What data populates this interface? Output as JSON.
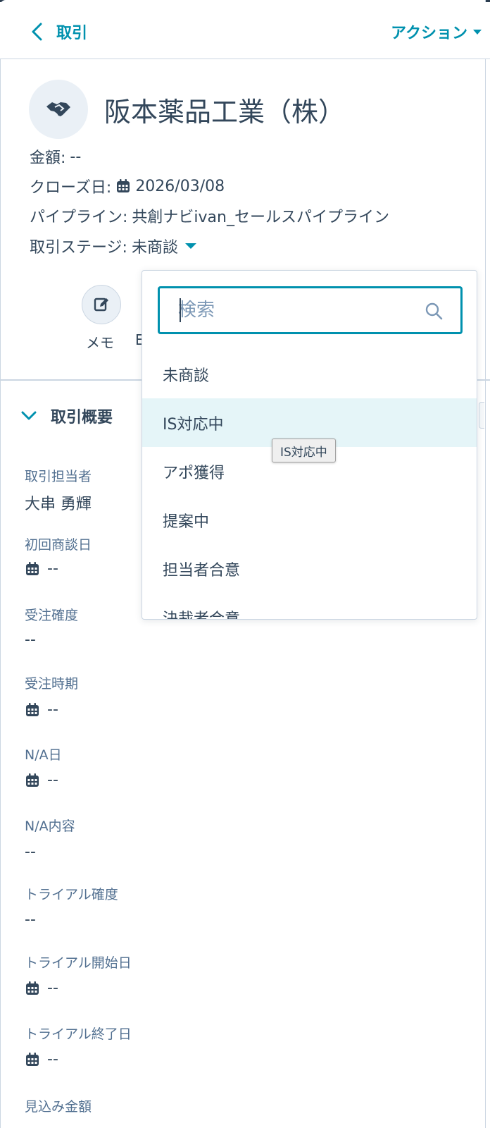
{
  "header": {
    "back_label": "取引",
    "actions_label": "アクション"
  },
  "record": {
    "title": "阪本薬品工業（株）",
    "amount_label": "金額:",
    "amount_value": "--",
    "close_date_label": "クローズ日:",
    "close_date_value": "2026/03/08",
    "pipeline_label": "パイプライン:",
    "pipeline_value": "共創ナビivan_セールスパイプライン",
    "stage_label": "取引ステージ:",
    "stage_value": "未商談"
  },
  "quick_actions": {
    "memo_label": "メモ",
    "next_label_partial": "E"
  },
  "summary": {
    "section_title": "取引概要",
    "fields": [
      {
        "label": "取引担当者",
        "value": "大串 勇輝"
      },
      {
        "label": "初回商談日",
        "value": "--"
      },
      {
        "label": "受注確度",
        "value": "--"
      },
      {
        "label": "受注時期",
        "value": "--"
      },
      {
        "label": "N/A日",
        "value": "--"
      },
      {
        "label": "N/A内容",
        "value": "--"
      },
      {
        "label": "トライアル確度",
        "value": "--"
      },
      {
        "label": "トライアル開始日",
        "value": "--"
      },
      {
        "label": "トライアル終了日",
        "value": "--"
      },
      {
        "label": "見込み金額",
        "value": ""
      }
    ]
  },
  "stage_dropdown": {
    "search_placeholder": "検索",
    "options": [
      "未商談",
      "IS対応中",
      "アポ獲得",
      "提案中",
      "担当者合意",
      "決裁者合意"
    ],
    "hovered_option": "IS対応中",
    "tooltip": "IS対応中"
  },
  "colors": {
    "accent": "#0091ae",
    "text": "#33475b",
    "muted": "#516f90",
    "hover_bg": "#e5f5f8"
  }
}
